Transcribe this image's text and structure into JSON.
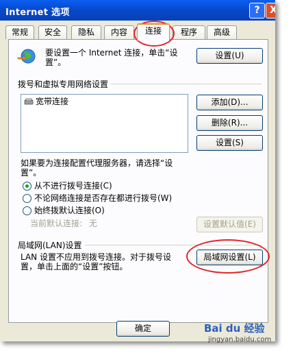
{
  "window": {
    "title": "Internet 选项",
    "help_glyph": "?",
    "close_glyph": "X"
  },
  "tabs": [
    {
      "label": "常规"
    },
    {
      "label": "安全"
    },
    {
      "label": "隐私"
    },
    {
      "label": "内容"
    },
    {
      "label": "连接"
    },
    {
      "label": "程序"
    },
    {
      "label": "高级"
    }
  ],
  "intro": {
    "text": "要设置一个 Internet 连接，单击“设置”。",
    "setup_button": "设置(U)"
  },
  "dialup_group": {
    "label": "拨号和虚拟专用网络设置",
    "connections": [
      "宽带连接"
    ],
    "add_button": "添加(D)...",
    "remove_button": "删除(R)...",
    "settings_button": "设置(S)"
  },
  "proxy": {
    "note": "如果要为连接配置代理服务器，请选择“设置”。",
    "options": [
      {
        "label": "从不进行拨号连接(C)",
        "checked": true
      },
      {
        "label": "不论网络连接是否存在都进行拨号(W)",
        "checked": false
      },
      {
        "label": "始终拨默认连接(O)",
        "checked": false
      }
    ],
    "current_default_label": "当前默认连接:",
    "current_default_value": "无",
    "set_default_button": "设置默认值(E)"
  },
  "lan_group": {
    "label": "局域网(LAN)设置",
    "text": "LAN 设置不应用到拨号连接。对于拨号设置，单击上面的“设置”按钮。",
    "lan_settings_button": "局域网设置(L)"
  },
  "footer": {
    "ok_button": "确定"
  },
  "watermark": {
    "brand": "Bai du 经验",
    "url": "jingyan.baidu.com"
  },
  "colors": {
    "titlebar": "#0a5ef0",
    "annotation": "#e0242b",
    "tab_highlight": "#e68b2c"
  }
}
